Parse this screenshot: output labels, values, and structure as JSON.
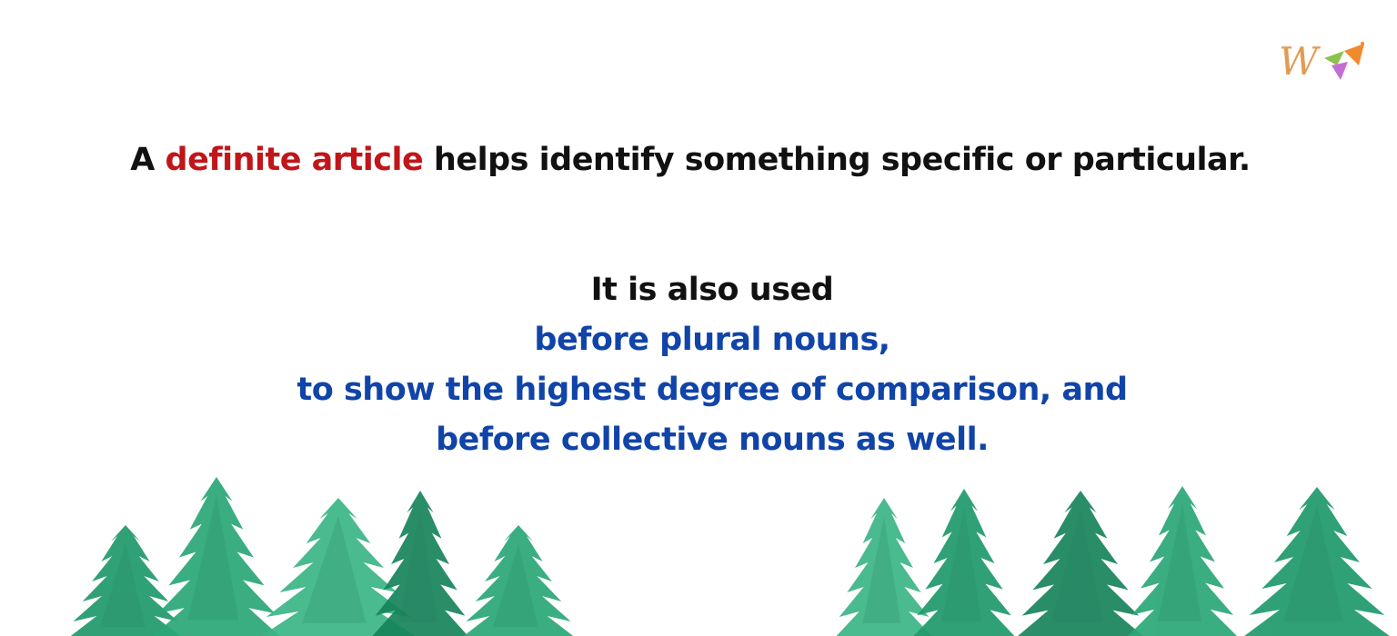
{
  "headline": {
    "prefix": "A ",
    "accent": "definite article",
    "suffix": " helps identify something specific or particular."
  },
  "body": {
    "intro": "It is also used",
    "points": [
      "before plural nouns,",
      "to show the highest degree of comparison, and",
      "before collective nouns as well."
    ]
  },
  "logo": {
    "icon": "w-pennant-logo-icon",
    "letter": "W"
  },
  "decoration": {
    "icon": "watercolor-pine-trees",
    "colors": [
      "#1f9a6c",
      "#2aa877",
      "#17845c",
      "#3bb586"
    ]
  },
  "colors": {
    "text": "#111111",
    "accent_red": "#c0161a",
    "accent_blue": "#1044a8"
  }
}
